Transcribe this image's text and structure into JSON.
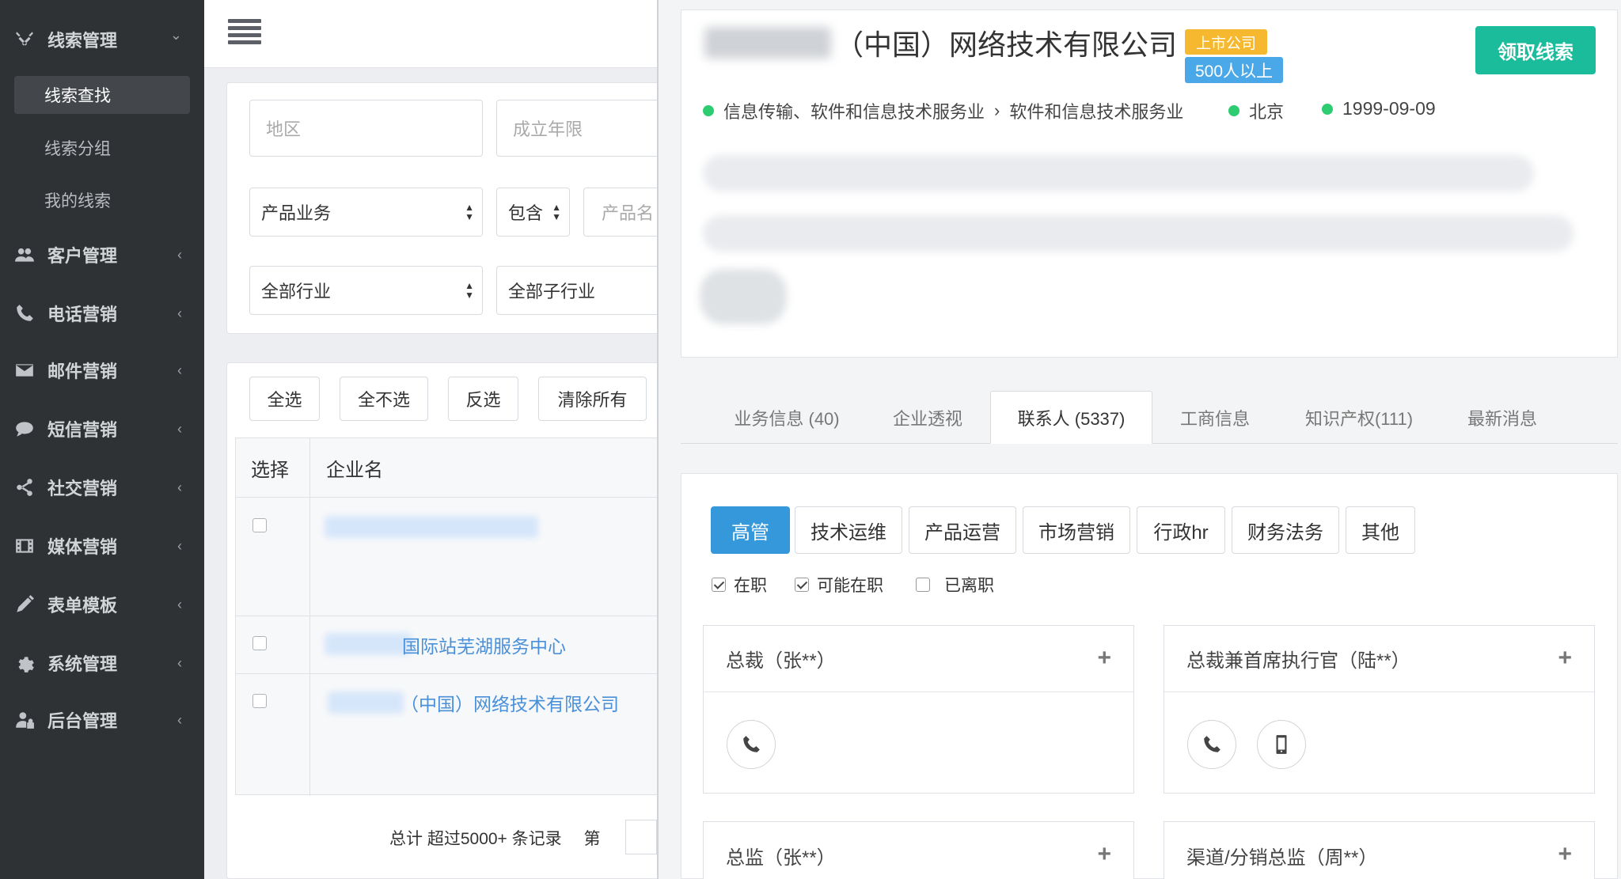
{
  "sidebar": {
    "menus": [
      {
        "label": "线索管理",
        "icon": "tools-icon",
        "chevron": "⌄"
      },
      {
        "label": "客户管理",
        "icon": "users-icon",
        "chevron": "‹"
      },
      {
        "label": "电话营销",
        "icon": "phone-icon",
        "chevron": "‹"
      },
      {
        "label": "邮件营销",
        "icon": "envelope-icon",
        "chevron": "‹"
      },
      {
        "label": "短信营销",
        "icon": "chat-bubble-icon",
        "chevron": "‹"
      },
      {
        "label": "社交营销",
        "icon": "share-icon",
        "chevron": "‹"
      },
      {
        "label": "媒体营销",
        "icon": "film-icon",
        "chevron": "‹"
      },
      {
        "label": "表单模板",
        "icon": "pencil-icon",
        "chevron": "‹"
      },
      {
        "label": "系统管理",
        "icon": "gear-icon",
        "chevron": "‹"
      },
      {
        "label": "后台管理",
        "icon": "user-lock-icon",
        "chevron": "‹"
      }
    ],
    "subitems": [
      "线索查找",
      "线索分组",
      "我的线索"
    ]
  },
  "filters": {
    "region_placeholder": "地区",
    "years_placeholder": "成立年限",
    "product_select": "产品业务",
    "contains_select": "包含",
    "product_name_placeholder": "产品名",
    "industry_select": "全部行业",
    "subindustry_select": "全部子行业"
  },
  "actions": {
    "select_all": "全选",
    "select_none": "全不选",
    "invert": "反选",
    "clear_all": "清除所有"
  },
  "table": {
    "headers": [
      "选择",
      "企业名"
    ],
    "rows": [
      {
        "name": ""
      },
      {
        "name": "国际站芜湖服务中心"
      },
      {
        "name": "（中国）网络技术有限公司"
      }
    ]
  },
  "footer": {
    "total": "总计 超过5000+ 条记录",
    "page_prefix": "第"
  },
  "detail": {
    "company_title": "（中国）网络技术有限公司",
    "badge_listed": "上市公司",
    "badge_size": "500人以上",
    "claim_button": "领取线索",
    "industry": "信息传输、软件和信息技术服务业",
    "separator": "›",
    "subindustry": "软件和信息技术服务业",
    "city": "北京",
    "founded": "1999-09-09",
    "tabs": [
      "业务信息 (40)",
      "企业透视",
      "联系人 (5337)",
      "工商信息",
      "知识产权(111)",
      "最新消息"
    ],
    "active_tab": 2,
    "roles": [
      "高管",
      "技术运维",
      "产品运营",
      "市场营销",
      "行政hr",
      "财务法务",
      "其他"
    ],
    "active_role": 0,
    "status_filters": [
      {
        "label": "在职",
        "checked": true
      },
      {
        "label": "可能在职",
        "checked": true
      },
      {
        "label": "已离职",
        "checked": false
      }
    ],
    "contacts": [
      {
        "title": "总裁（张**）"
      },
      {
        "title": "总裁兼首席执行官（陆**）"
      },
      {
        "title": "总监（张**）"
      },
      {
        "title": "渠道/分销总监（周**）"
      }
    ],
    "plus": "+"
  },
  "colors": {
    "sidebar_bg": "#2f3235",
    "accent_green": "#1abc9c",
    "accent_blue": "#3498db",
    "badge_yellow": "#f5b82e",
    "link_blue": "#4a90d9"
  }
}
